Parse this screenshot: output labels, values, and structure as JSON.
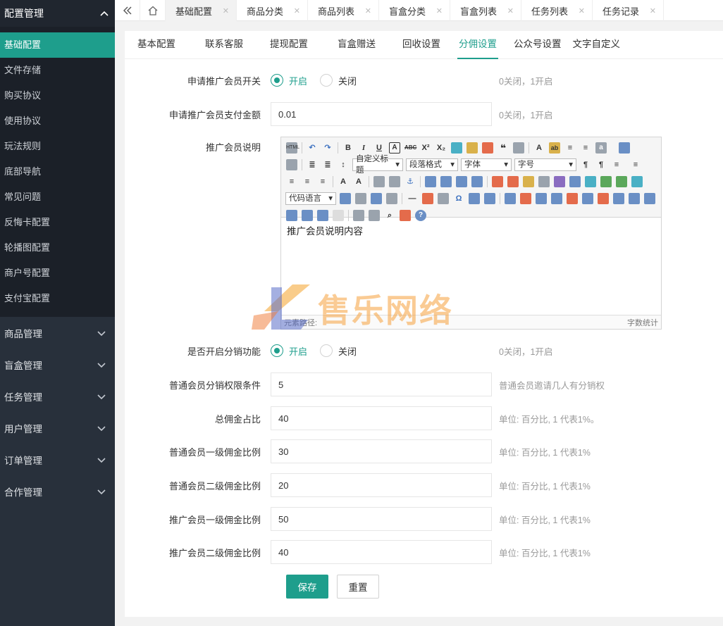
{
  "sidebar": {
    "section_title": "配置管理",
    "sub_items": [
      {
        "label": "基础配置",
        "active": true
      },
      {
        "label": "文件存储"
      },
      {
        "label": "购买协议"
      },
      {
        "label": "使用协议"
      },
      {
        "label": "玩法规则"
      },
      {
        "label": "底部导航"
      },
      {
        "label": "常见问题"
      },
      {
        "label": "反悔卡配置"
      },
      {
        "label": "轮播图配置"
      },
      {
        "label": "商户号配置"
      },
      {
        "label": "支付宝配置"
      }
    ],
    "groups": [
      {
        "label": "商品管理"
      },
      {
        "label": "盲盒管理"
      },
      {
        "label": "任务管理"
      },
      {
        "label": "用户管理"
      },
      {
        "label": "订单管理"
      },
      {
        "label": "合作管理"
      }
    ]
  },
  "tabbar": {
    "tabs": [
      {
        "label": "基础配置",
        "active": true
      },
      {
        "label": "商品分类"
      },
      {
        "label": "商品列表"
      },
      {
        "label": "盲盒分类"
      },
      {
        "label": "盲盒列表"
      },
      {
        "label": "任务列表"
      },
      {
        "label": "任务记录"
      }
    ],
    "close_glyph": "✕"
  },
  "subtabs": [
    {
      "label": "基本配置"
    },
    {
      "label": "联系客服"
    },
    {
      "label": "提现配置"
    },
    {
      "label": "盲盒赠送"
    },
    {
      "label": "回收设置"
    },
    {
      "label": "分佣设置",
      "active": true
    },
    {
      "label": "公众号设置"
    },
    {
      "label": "文字自定义"
    }
  ],
  "form": {
    "apply_switch": {
      "label": "申请推广会员开关",
      "on": "开启",
      "off": "关闭",
      "hint": "0关闭，1开启",
      "value": "开启"
    },
    "apply_amount": {
      "label": "申请推广会员支付金额",
      "value": "0.01",
      "hint": "0关闭，1开启"
    },
    "description": {
      "label": "推广会员说明",
      "content": "推广会员说明内容",
      "path_label": "元素路径:",
      "word_count": "字数统计",
      "selects": {
        "heading": "自定义标题",
        "paragraph": "段落格式",
        "font": "字体",
        "size": "字号",
        "code": "代码语言"
      }
    },
    "distribution_switch": {
      "label": "是否开启分销功能",
      "on": "开启",
      "off": "关闭",
      "hint": "0关闭，1开启",
      "value": "开启"
    },
    "normal_condition": {
      "label": "普通会员分销权限条件",
      "value": "5",
      "hint": "普通会员邀请几人有分销权"
    },
    "total_ratio": {
      "label": "总佣金占比",
      "value": "40",
      "hint": "单位: 百分比, 1 代表1%。"
    },
    "normal_level1": {
      "label": "普通会员一级佣金比例",
      "value": "30",
      "hint": "单位: 百分比, 1 代表1%"
    },
    "normal_level2": {
      "label": "普通会员二级佣金比例",
      "value": "20",
      "hint": "单位: 百分比, 1 代表1%"
    },
    "promo_level1": {
      "label": "推广会员一级佣金比例",
      "value": "50",
      "hint": "单位: 百分比, 1 代表1%"
    },
    "promo_level2": {
      "label": "推广会员二级佣金比例",
      "value": "40",
      "hint": "单位: 百分比, 1 代表1%"
    }
  },
  "buttons": {
    "save": "保存",
    "reset": "重置"
  },
  "watermark": {
    "text": "售乐网络"
  },
  "colors": {
    "accent": "#1e9e8c",
    "sidebar_bg": "#28303b"
  }
}
